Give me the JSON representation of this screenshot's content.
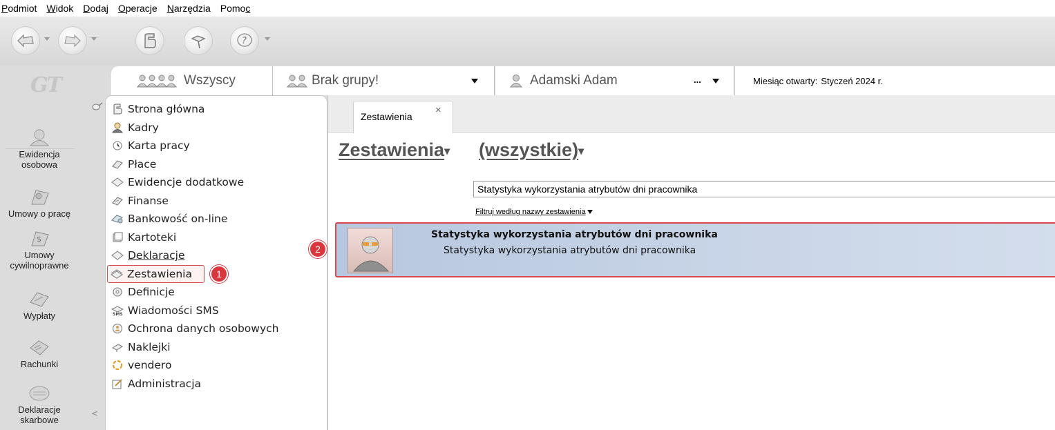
{
  "menu": {
    "items": [
      {
        "pre": "",
        "ul": "P",
        "post": "odmiot"
      },
      {
        "pre": "",
        "ul": "W",
        "post": "idok"
      },
      {
        "pre": "",
        "ul": "D",
        "post": "odaj"
      },
      {
        "pre": "",
        "ul": "O",
        "post": "peracje"
      },
      {
        "pre": "",
        "ul": "N",
        "post": "arzędzia"
      },
      {
        "pre": "Pomo",
        "ul": "c",
        "post": ""
      }
    ]
  },
  "toolbar": {
    "icons": [
      "back-arrow-icon",
      "forward-arrow-icon",
      "home-icon",
      "pin-icon",
      "help-icon"
    ]
  },
  "logo_text": "GT",
  "left_nav": {
    "items": [
      {
        "label": "Ewidencja osobowa",
        "icon": "person-icon"
      },
      {
        "label": "Umowy o pracę",
        "icon": "contract-person-icon"
      },
      {
        "label": "Umowy cywilnoprawne",
        "icon": "contract-civil-icon"
      },
      {
        "label": "Wypłaty",
        "icon": "payout-icon"
      },
      {
        "label": "Rachunki",
        "icon": "invoice-icon"
      },
      {
        "label": "Deklaracje skarbowe",
        "icon": "tax-declaration-icon"
      }
    ],
    "scroll_glyph": "<"
  },
  "topbar": {
    "group_all": "Wszyscy",
    "group_none": "Brak grupy!",
    "employee": "Adamski Adam",
    "employee_more": "...",
    "month_label": "Miesiąc otwarty:",
    "month_value": "Styczeń 2024 r."
  },
  "nav": {
    "items": [
      {
        "label": "Strona główna",
        "icon": "home-icon"
      },
      {
        "label": "Kadry",
        "icon": "staff-icon"
      },
      {
        "label": "Karta pracy",
        "icon": "worksheet-icon"
      },
      {
        "label": "Płace",
        "icon": "wages-icon"
      },
      {
        "label": "Ewidencje dodatkowe",
        "icon": "extra-records-icon"
      },
      {
        "label": "Finanse",
        "icon": "finance-icon"
      },
      {
        "label": "Bankowość on-line",
        "icon": "online-banking-icon"
      },
      {
        "label": "Kartoteki",
        "icon": "files-icon"
      },
      {
        "label": "Deklaracje",
        "icon": "declarations-icon",
        "underline": true
      },
      {
        "label": "Zestawienia",
        "icon": "reports-icon",
        "active": true
      },
      {
        "label": "Definicje",
        "icon": "definitions-icon"
      },
      {
        "label": "Wiadomości SMS",
        "icon": "sms-icon"
      },
      {
        "label": "Ochrona danych osobowych",
        "icon": "data-protection-icon"
      },
      {
        "label": "Naklejki",
        "icon": "stickers-icon"
      },
      {
        "label": "vendero",
        "icon": "vendero-icon"
      },
      {
        "label": "Administracja",
        "icon": "admin-icon"
      }
    ],
    "badge_active": "1"
  },
  "content": {
    "tab_label": "Zestawienia",
    "tab_close": "×",
    "title": "Zestawienia",
    "filter": "(wszystkie)",
    "search_value": "Statystyka wykorzystania atrybutów dni pracownika",
    "filter_link": "Filtruj według nazwy zestawienia",
    "result_title": "Statystyka wykorzystania atrybutów dni pracownika",
    "result_sub": "Statystyka wykorzystania atrybutów dni pracownika",
    "badge_result": "2"
  },
  "colors": {
    "accent_red": "#d9363e",
    "selection_blue": "#b7c7df"
  }
}
